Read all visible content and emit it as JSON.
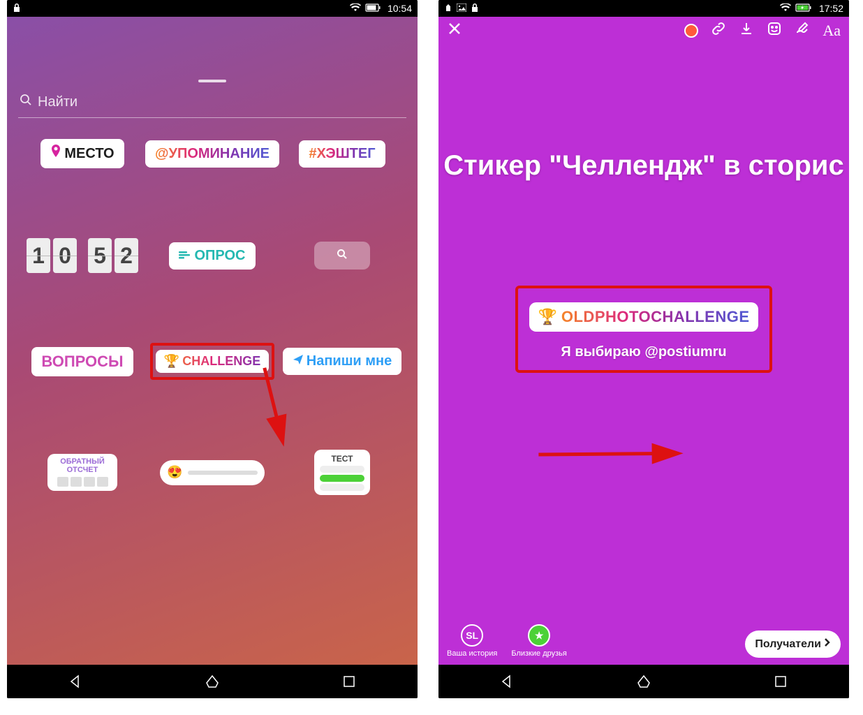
{
  "left": {
    "status": {
      "time": "10:54"
    },
    "search_placeholder": "Найти",
    "stickers": {
      "location": "МЕСТО",
      "mention": "@УПОМИНАНИЕ",
      "hashtag": "#ХЭШТЕГ",
      "clock_digits": [
        "1",
        "0",
        "5",
        "2"
      ],
      "poll": "ОПРОС",
      "questions": "ВОПРОСЫ",
      "challenge": "CHALLENGE",
      "dm_me": "Напиши мне",
      "countdown": "ОБРАТНЫЙ ОТСЧЕТ",
      "quiz": "ТЕСТ"
    }
  },
  "right": {
    "status": {
      "time": "17:52"
    },
    "toolbar_text": "Aa",
    "headline": "Стикер \"Челлендж\" в сторис",
    "challenge_text": "OLDPHOTOCHALLENGE",
    "choose_text": "Я выбираю @postiumru",
    "your_story": "Ваша история",
    "close_friends": "Близкие друзья",
    "recipients": "Получатели"
  }
}
